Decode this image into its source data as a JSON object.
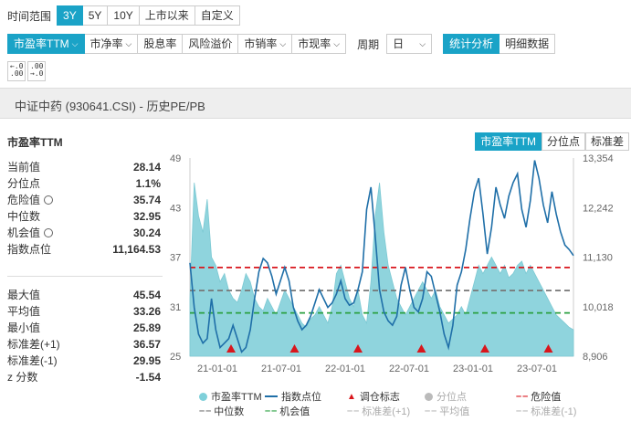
{
  "time_range": {
    "label": "时间范围",
    "options": [
      "3Y",
      "5Y",
      "10Y",
      "上市以来",
      "自定义"
    ],
    "selected": "3Y"
  },
  "metrics": [
    {
      "label": "市盈率TTM",
      "active": true
    },
    {
      "label": "市净率",
      "active": false
    },
    {
      "label": "股息率",
      "active": false,
      "dropdown": false
    },
    {
      "label": "风险溢价",
      "active": false,
      "dropdown": false
    },
    {
      "label": "市销率",
      "active": false
    },
    {
      "label": "市现率",
      "active": false
    }
  ],
  "period": {
    "label": "周期",
    "value": "日"
  },
  "view_tabs": [
    "统计分析",
    "明细数据"
  ],
  "decimal_buttons": [
    ".0\n.00",
    ".00\n.0"
  ],
  "title": "中证中药 (930641.CSI) - 历史PE/PB",
  "panel_title": "市盈率TTM",
  "stats_top": [
    {
      "label": "当前值",
      "value": "28.14",
      "gear": false
    },
    {
      "label": "分位点",
      "value": "1.1%",
      "gear": false
    },
    {
      "label": "危险值",
      "value": "35.74",
      "gear": true
    },
    {
      "label": "中位数",
      "value": "32.95",
      "gear": false
    },
    {
      "label": "机会值",
      "value": "30.24",
      "gear": true
    },
    {
      "label": "指数点位",
      "value": "11,164.53",
      "gear": false
    }
  ],
  "stats_bottom": [
    {
      "label": "最大值",
      "value": "45.54"
    },
    {
      "label": "平均值",
      "value": "33.26"
    },
    {
      "label": "最小值",
      "value": "25.89"
    },
    {
      "label": "标准差(+1)",
      "value": "36.57"
    },
    {
      "label": "标准差(-1)",
      "value": "29.95"
    },
    {
      "label": "z 分数",
      "value": "-1.54"
    }
  ],
  "chart_tabs": [
    "市盈率TTM",
    "分位点",
    "标准差"
  ],
  "legend": [
    {
      "label": "市盈率TTM",
      "type": "dot",
      "color": "#7fd0da",
      "faded": false
    },
    {
      "label": "指数点位",
      "type": "line",
      "color": "#1f6fa8",
      "faded": false
    },
    {
      "label": "调仓标志",
      "type": "triangle",
      "color": "#d9161c",
      "faded": false
    },
    {
      "label": "分位点",
      "type": "dot",
      "color": "#bbbbbb",
      "faded": true
    },
    {
      "label": "危险值",
      "type": "dash",
      "color": "#d9161c",
      "faded": false
    },
    {
      "label": "中位数",
      "type": "dash",
      "color": "#777777",
      "faded": false
    },
    {
      "label": "机会值",
      "type": "dash",
      "color": "#2aa040",
      "faded": false
    },
    {
      "label": "标准差(+1)",
      "type": "dash",
      "color": "#bbbbbb",
      "faded": true
    },
    {
      "label": "平均值",
      "type": "dash",
      "color": "#bbbbbb",
      "faded": true
    },
    {
      "label": "标准差(-1)",
      "type": "dash",
      "color": "#bbbbbb",
      "faded": true
    }
  ],
  "chart_data": {
    "type": "area",
    "title": "",
    "left_axis": {
      "ticks": [
        49,
        43,
        37,
        31,
        25
      ],
      "ylim": [
        25,
        49
      ]
    },
    "right_axis": {
      "ticks": [
        "13,354",
        "12,242",
        "11,130",
        "10,018",
        "8,906"
      ],
      "ylim": [
        8906,
        13354
      ]
    },
    "x_ticks": [
      "21-01-01",
      "21-07-01",
      "22-01-01",
      "22-07-01",
      "23-01-01",
      "23-07-01"
    ],
    "reference_lines": {
      "危险值": 35.74,
      "中位数": 32.95,
      "机会值": 30.24
    },
    "rebalance_markers": [
      "21-01-01",
      "21-07-01",
      "22-01-01",
      "22-07-01",
      "23-01-01",
      "23-07-01"
    ],
    "pe_ttm": [
      32,
      46,
      42,
      40,
      44,
      37,
      36,
      34,
      35,
      33,
      32,
      31.5,
      33,
      35,
      34,
      32,
      31,
      30.5,
      32,
      31,
      30,
      31.5,
      33,
      32,
      31,
      30,
      29,
      28.5,
      29.5,
      30,
      31,
      30,
      29,
      31,
      35,
      36,
      34,
      32,
      31,
      33,
      30,
      29,
      34,
      42,
      46,
      40,
      36,
      34,
      32,
      31,
      30,
      31,
      32,
      33,
      34,
      33,
      32,
      33,
      31,
      30,
      29,
      29.5,
      30,
      31,
      30,
      32,
      34,
      36,
      35,
      36,
      37,
      36,
      35,
      36,
      34.5,
      35,
      36,
      36.5,
      35,
      36,
      35,
      34,
      33,
      32,
      31,
      30,
      29.5,
      29,
      28.5,
      28.2
    ],
    "index": [
      11000,
      10000,
      9400,
      9200,
      9300,
      10200,
      9500,
      9100,
      9200,
      9300,
      9600,
      9300,
      9000,
      9100,
      9500,
      10200,
      10800,
      11100,
      11000,
      10700,
      10300,
      10600,
      10900,
      10600,
      10000,
      9700,
      9500,
      9600,
      9800,
      10100,
      10400,
      10200,
      10000,
      10100,
      10300,
      10600,
      10200,
      10050,
      10100,
      10400,
      10800,
      12200,
      12700,
      11600,
      10400,
      9900,
      9700,
      9600,
      9800,
      10500,
      10900,
      10400,
      10000,
      9900,
      10200,
      10800,
      10700,
      10300,
      9900,
      9400,
      9100,
      9600,
      10500,
      10800,
      11300,
      12000,
      12600,
      12900,
      12100,
      11200,
      11800,
      12700,
      12300,
      12000,
      12500,
      12800,
      13000,
      12200,
      11800,
      12400,
      13300,
      12900,
      12300,
      11900,
      12600,
      12100,
      11700,
      11400,
      11300,
      11165
    ]
  }
}
